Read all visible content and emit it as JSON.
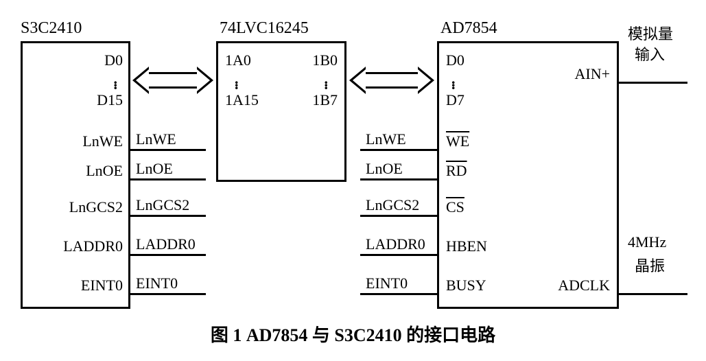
{
  "caption": "图 1  AD7854 与 S3C2410 的接口电路",
  "chip1": {
    "title": "S3C2410",
    "pins": {
      "d0": "D0",
      "d15": "D15",
      "lnwe": "LnWE",
      "lnoe": "LnOE",
      "lngcs2": "LnGCS2",
      "laddr0": "LADDR0",
      "eint0": "EINT0"
    }
  },
  "chip2": {
    "title": "74LVC16245",
    "pins": {
      "a0": "1A0",
      "a15": "1A15",
      "b0": "1B0",
      "b7": "1B7"
    }
  },
  "chip3": {
    "title": "AD7854",
    "pins": {
      "d0": "D0",
      "d7": "D7",
      "we": "WE",
      "rd": "RD",
      "cs": "CS",
      "hben": "HBEN",
      "busy": "BUSY",
      "ain": "AIN+",
      "adclk": "ADCLK"
    }
  },
  "wires": {
    "lnwe": "LnWE",
    "lnoe": "LnOE",
    "lngcs2": "LnGCS2",
    "laddr0": "LADDR0",
    "eint0": "EINT0"
  },
  "ext": {
    "analog1": "模拟量",
    "analog2": "输入",
    "clk1": "4MHz",
    "clk2": "晶振"
  }
}
